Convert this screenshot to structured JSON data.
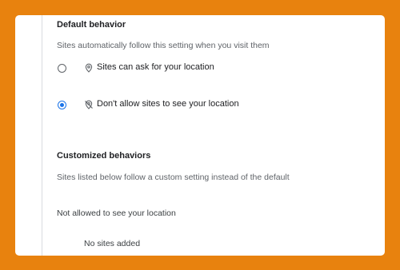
{
  "default_behavior": {
    "heading": "Default behavior",
    "description": "Sites automatically follow this setting when you visit them",
    "options": [
      {
        "label": "Sites can ask for your location",
        "icon": "location-pin-icon",
        "selected": false
      },
      {
        "label": "Don't allow sites to see your location",
        "icon": "location-off-icon",
        "selected": true
      }
    ]
  },
  "customized_behaviors": {
    "heading": "Customized behaviors",
    "description": "Sites listed below follow a custom setting instead of the default",
    "not_allowed_heading": "Not allowed to see your location",
    "empty_message": "No sites added"
  },
  "colors": {
    "background": "#e8820e",
    "accent": "#1a73e8"
  }
}
